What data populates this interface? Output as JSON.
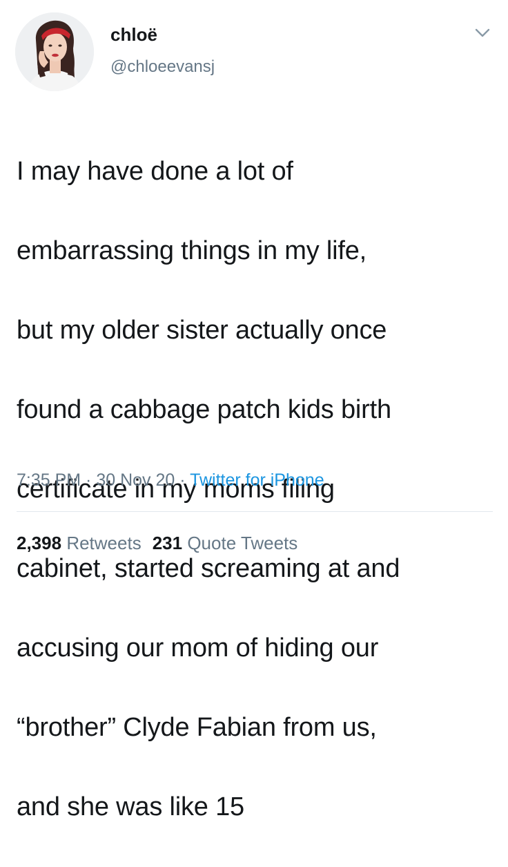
{
  "user": {
    "display_name": "chloë",
    "handle": "@chloeevansj",
    "avatar_icon": "profile-photo-avatar"
  },
  "menu": {
    "icon": "chevron-down-icon"
  },
  "tweet": {
    "text_lines": [
      "I may have done a lot of",
      "embarrassing things in my life,",
      "but my older sister actually once",
      "found a cabbage patch kids birth",
      "certificate in my moms filing",
      "cabinet, started screaming at and",
      "accusing our mom of hiding our",
      "“brother” Clyde Fabian from us,",
      "and she was like 15"
    ]
  },
  "meta": {
    "time": "7:35 PM",
    "separator": " · ",
    "date": "30 Nov 20",
    "source": "Twitter for iPhone"
  },
  "stats": {
    "retweets_count": "2,398",
    "retweets_label": "Retweets",
    "quotes_count": "231",
    "quotes_label": "Quote Tweets"
  },
  "colors": {
    "text": "#14171a",
    "secondary": "#657786",
    "link": "#1b95e0",
    "divider": "#e1e8ed"
  }
}
